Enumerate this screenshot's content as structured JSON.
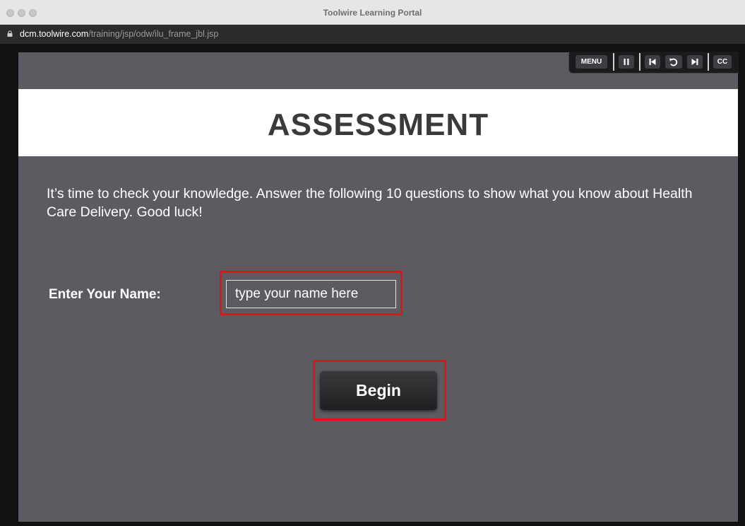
{
  "window": {
    "title": "Toolwire Learning Portal"
  },
  "address_bar": {
    "host": "dcm.toolwire.com",
    "path": "/training/jsp/odw/ilu_frame_jbl.jsp"
  },
  "player_controls": {
    "menu_label": "MENU",
    "cc_label": "CC",
    "icons": [
      "pause-icon",
      "skip-back-icon",
      "replay-icon",
      "skip-forward-icon"
    ]
  },
  "slide": {
    "title": "ASSESSMENT",
    "intro": "It’s time to check your knowledge. Answer the following 10 questions to show what you know about Health Care Delivery. Good luck!",
    "name_label": "Enter Your Name:",
    "name_placeholder": "type your name here",
    "begin_label": "Begin"
  },
  "colors": {
    "stage": "#5c5b61",
    "highlight": "#e0151b",
    "banner": "#ffffff",
    "heading": "#3a3a3a"
  }
}
